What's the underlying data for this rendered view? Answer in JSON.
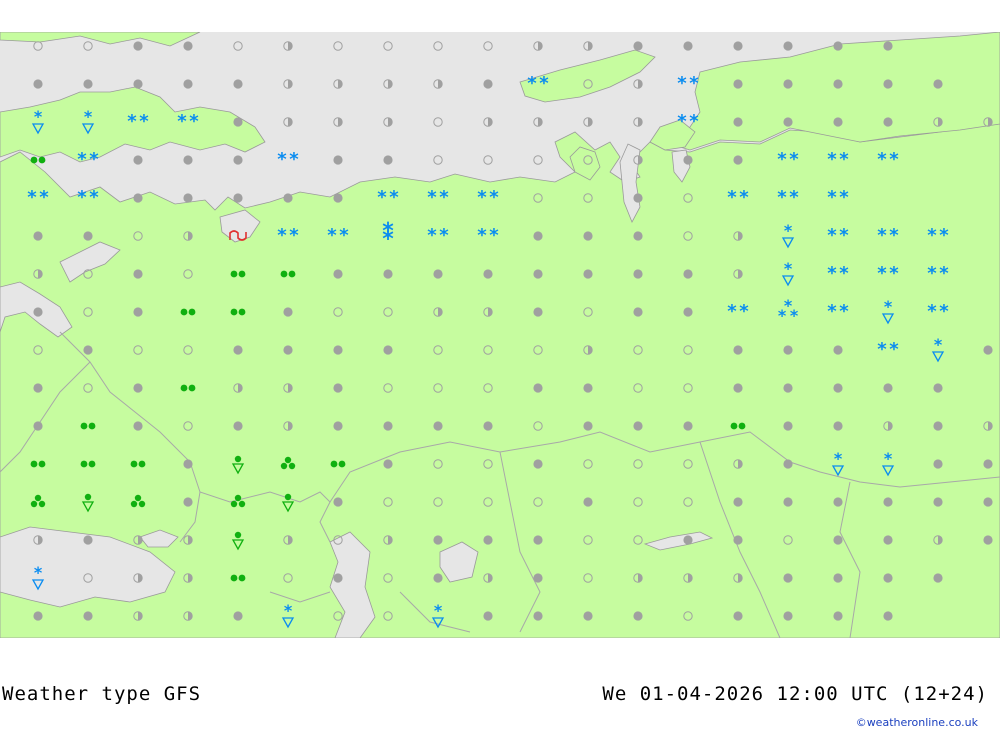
{
  "footer": {
    "title": "Weather type  GFS",
    "datetime": "We 01-04-2026 12:00 UTC (12+24)",
    "credit": "©weatheronline.co.uk"
  },
  "colors": {
    "sea": "#e6e6e6",
    "land": "#c6fc9f",
    "cloud_dot": "#a0a0a0",
    "snow": "#0a8cf0",
    "rain": "#10b010",
    "thunder": "#e03030",
    "border": "#a8a8a8"
  },
  "legend_icons": {
    "o": "clear-icon",
    "h": "partly-cloudy-icon",
    "c": "overcast-icon",
    "S": "snow-icon",
    "Q": "heavy-snow-icon",
    "X": "snow-storm-icon",
    "V": "snow-shower-icon",
    "R": "rain-icon",
    "T": "heavy-rain-icon",
    "W": "rain-shower-icon",
    "Z": "thunder-icon"
  },
  "grid": [
    "ooccohoooohhcccccc",
    "ccccchhhhcSohSccccc",
    "VVSSchhhohhhhScccchh",
    "RScccSccoooohccSSS",
    "SScccccSSSoocoSSS",
    "ccohZSSXSScccohVSSS",
    "hocoRRcccccccchVSSS",
    "cocRRcoohhcoccSQSVS",
    "ocooccccooohoocccSVc",
    "cocRhhcoooccooccccc",
    "cRcochccccocccRcchch",
    "RRRcWTRcoocooohcVVcc",
    "TWTcTWcoooocoocccccc",
    "hchhWhohcccooccocchc",
    "VohhRocochcohhhcccc",
    "cchhcVooVccccocccc"
  ]
}
